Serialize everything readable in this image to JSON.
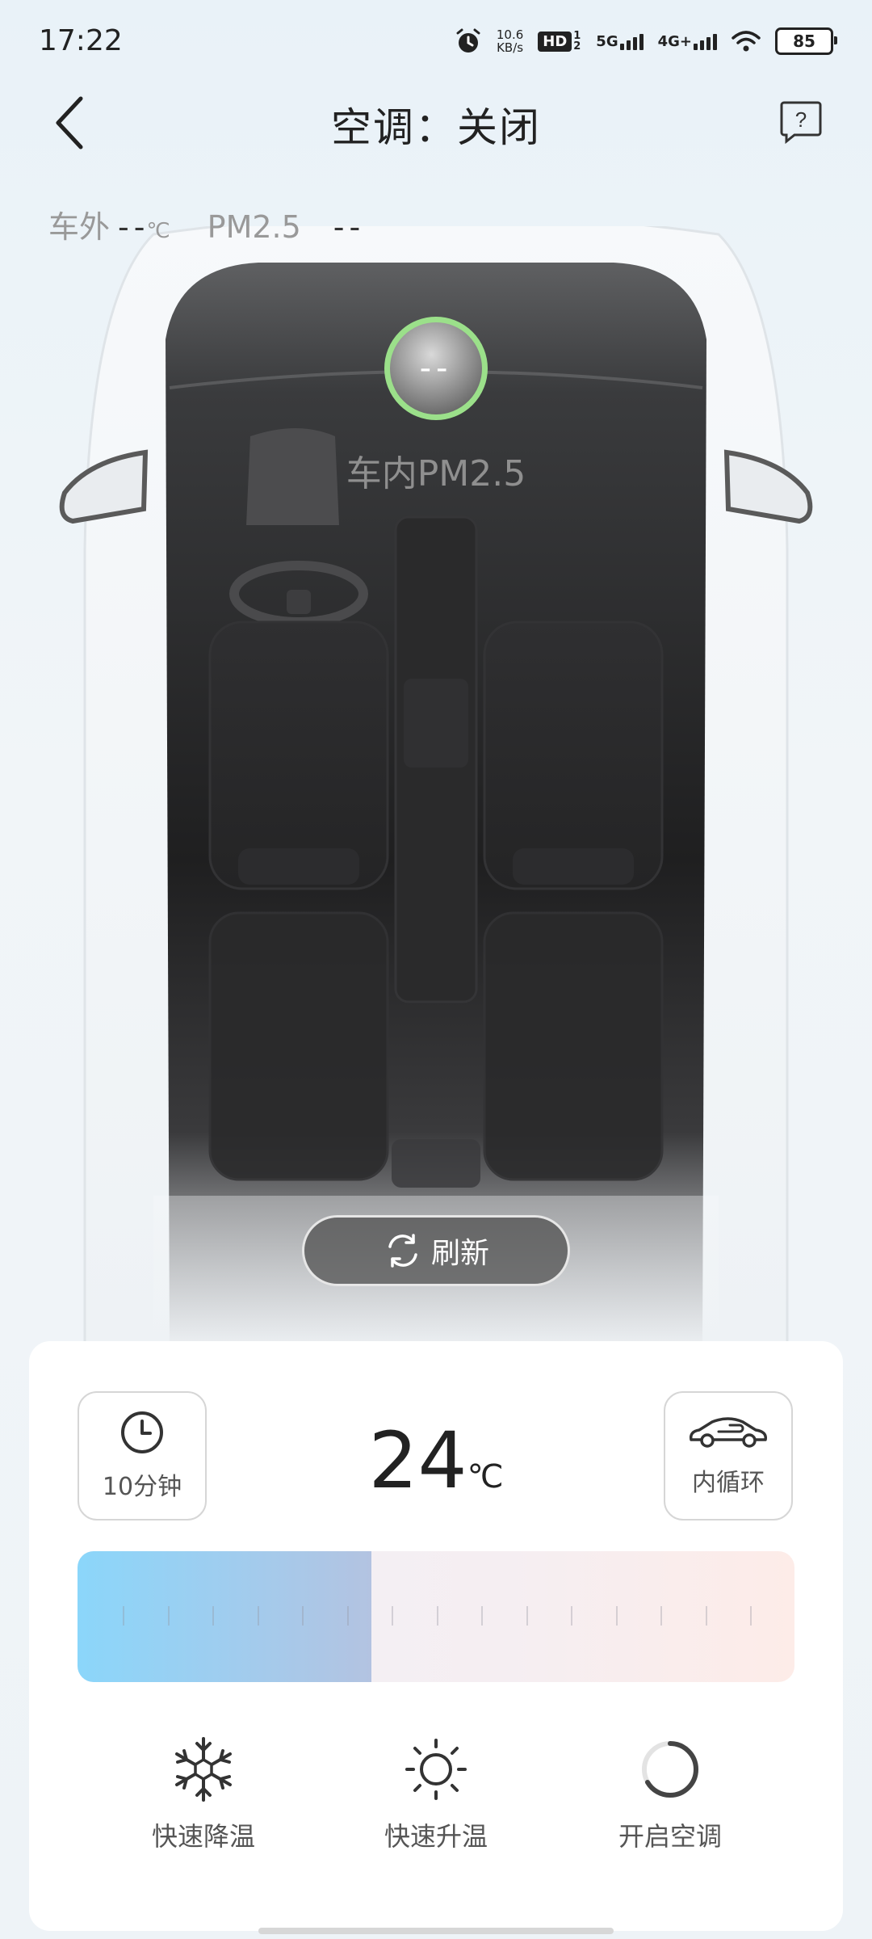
{
  "status_bar": {
    "time": "17:22",
    "net_speed_value": "10.6",
    "net_speed_unit": "KB/s",
    "hd_label": "HD",
    "hd_sub": "1 2",
    "sig1_label": "5G",
    "sig2_label": "4G+",
    "battery": "85"
  },
  "header": {
    "title": "空调：关闭"
  },
  "outside": {
    "label": "车外",
    "temp_value": "--",
    "temp_unit": "℃",
    "pm_label": "PM2.5",
    "pm_value": "--"
  },
  "inside": {
    "pm_value": "--",
    "pm_label": "车内PM2.5"
  },
  "refresh_label": "刷新",
  "controls": {
    "timer_label": "10分钟",
    "temperature": "24",
    "temperature_unit": "℃",
    "circulation_label": "内循环",
    "slider_level_fraction": 0.41
  },
  "actions": {
    "cool_label": "快速降温",
    "heat_label": "快速升温",
    "power_label": "开启空调"
  },
  "colors": {
    "ring_green": "#9be08a",
    "slider_cool": "#8bd6fa",
    "slider_warm": "#fdece8"
  },
  "icons": [
    "alarm-icon",
    "wifi-icon",
    "back-chevron-icon",
    "help-icon",
    "refresh-icon",
    "clock-icon",
    "car-circulation-icon",
    "snowflake-icon",
    "sun-icon",
    "power-spinner-icon"
  ]
}
